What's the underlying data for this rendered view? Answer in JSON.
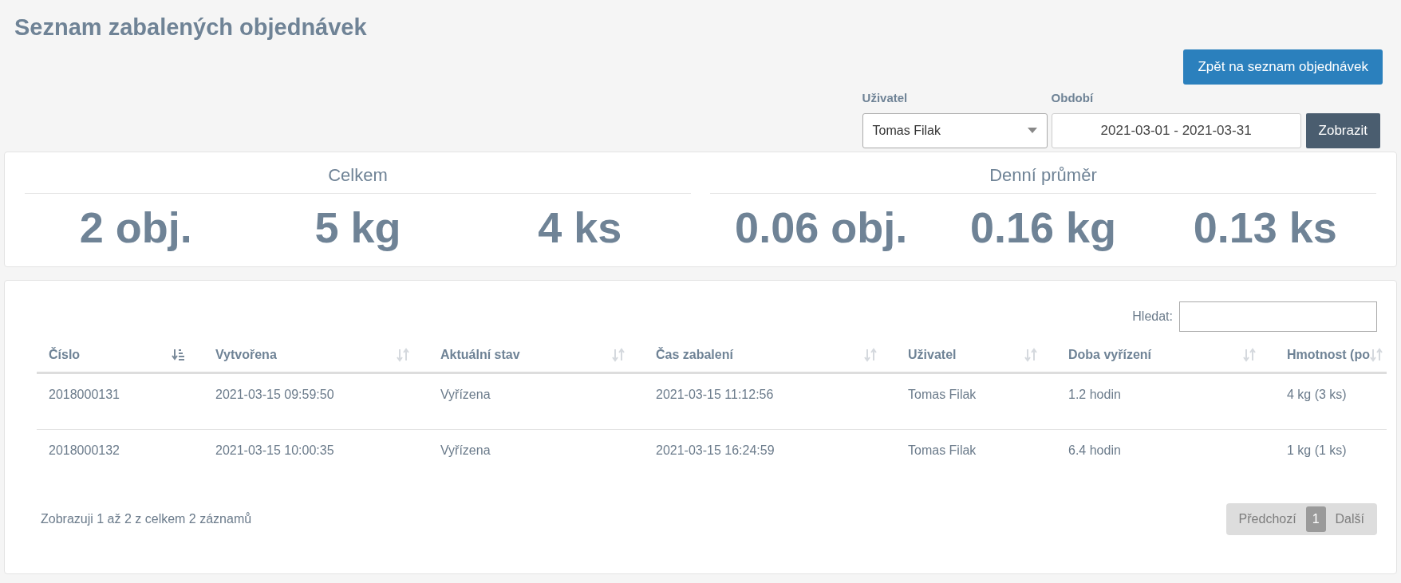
{
  "title": "Seznam zabalených objednávek",
  "back_button": "Zpět na seznam objednávek",
  "filters": {
    "user_label": "Uživatel",
    "user_value": "Tomas Filak",
    "period_label": "Období",
    "period_value": "2021-03-01 - 2021-03-31",
    "submit": "Zobrazit"
  },
  "stats": [
    {
      "heading": "Celkem",
      "values": [
        "2 obj.",
        "5 kg",
        "4 ks"
      ]
    },
    {
      "heading": "Denní průměr",
      "values": [
        "0.06 obj.",
        "0.16 kg",
        "0.13 ks"
      ]
    }
  ],
  "search_label": "Hledat:",
  "table": {
    "columns": [
      {
        "label": "Číslo",
        "sorted": true
      },
      {
        "label": "Vytvořena",
        "sorted": false
      },
      {
        "label": "Aktuální stav",
        "sorted": false
      },
      {
        "label": "Čas zabalení",
        "sorted": false
      },
      {
        "label": "Uživatel",
        "sorted": false
      },
      {
        "label": "Doba vyřízení",
        "sorted": false
      },
      {
        "label": "Hmotnost (po",
        "sorted": false
      }
    ],
    "rows": [
      [
        "2018000131",
        "2021-03-15 09:59:50",
        "Vyřízena",
        "2021-03-15 11:12:56",
        "Tomas Filak",
        "1.2 hodin",
        "4 kg (3 ks)"
      ],
      [
        "2018000132",
        "2021-03-15 10:00:35",
        "Vyřízena",
        "2021-03-15 16:24:59",
        "Tomas Filak",
        "6.4 hodin",
        "1 kg (1 ks)"
      ]
    ]
  },
  "info": "Zobrazuji 1 až 2 z celkem 2 záznamů",
  "pagination": [
    {
      "label": "Předchozí",
      "disabled": true,
      "selected": false
    },
    {
      "label": "1",
      "disabled": false,
      "selected": true
    },
    {
      "label": "Další",
      "disabled": true,
      "selected": false
    }
  ]
}
